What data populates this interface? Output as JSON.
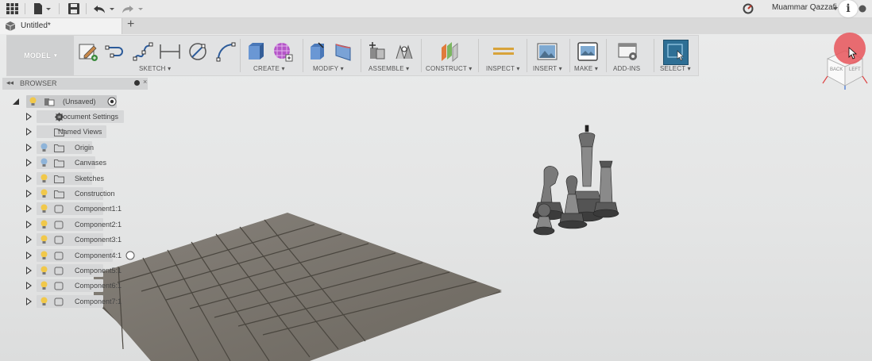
{
  "toolbar": {
    "user_name": "Muammar Qazzafi",
    "info_glyph": "i"
  },
  "tab": {
    "title": "Untitled*",
    "add_glyph": "+"
  },
  "ribbon": {
    "workspace": "MODEL",
    "groups": [
      "SKETCH",
      "CREATE",
      "MODIFY",
      "ASSEMBLE",
      "CONSTRUCT",
      "INSPECT",
      "INSERT",
      "MAKE",
      "ADD-INS",
      "SELECT"
    ]
  },
  "browser": {
    "title": "BROWSER",
    "root": "(Unsaved)",
    "items": [
      "Document Settings",
      "Named Views",
      "Origin",
      "Canvases",
      "Sketches",
      "Construction",
      "Component1:1",
      "Component2:1",
      "Component3:1",
      "Component4:1",
      "Component5:1",
      "Component6:1",
      "Component7:1"
    ]
  },
  "viewcube": {
    "back": "BACK",
    "left": "LEFT"
  },
  "colors": {
    "accent": "#e8555b",
    "select_blue": "#2e6f95",
    "board": "#7a746a",
    "bulb_on": "#f1c84a",
    "bulb_off": "#8fb4d9"
  }
}
